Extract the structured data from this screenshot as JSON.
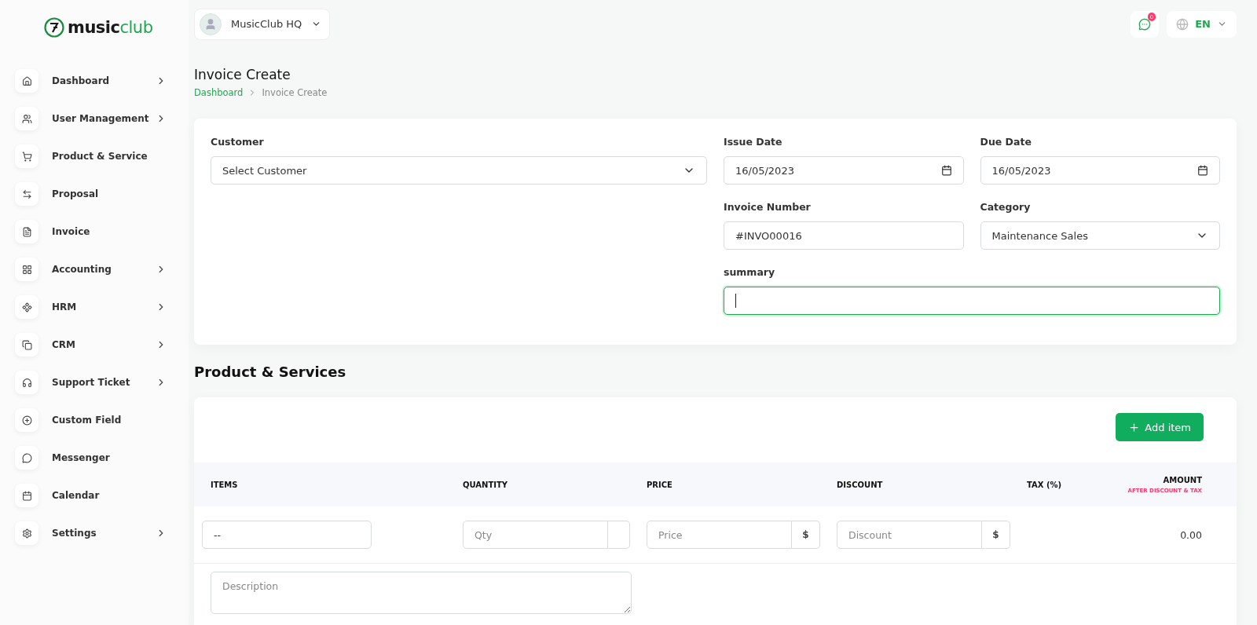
{
  "logo": {
    "part1": "music",
    "part2": "club"
  },
  "workspace": {
    "name": "MusicClub HQ"
  },
  "topbar": {
    "notifications": "0",
    "language": "EN"
  },
  "sidebar": {
    "items": [
      {
        "label": "Dashboard",
        "has_submenu": true
      },
      {
        "label": "User Management",
        "has_submenu": true
      },
      {
        "label": "Product & Service",
        "has_submenu": false
      },
      {
        "label": "Proposal",
        "has_submenu": false
      },
      {
        "label": "Invoice",
        "has_submenu": false
      },
      {
        "label": "Accounting",
        "has_submenu": true
      },
      {
        "label": "HRM",
        "has_submenu": true
      },
      {
        "label": "CRM",
        "has_submenu": true
      },
      {
        "label": "Support Ticket",
        "has_submenu": true
      },
      {
        "label": "Custom Field",
        "has_submenu": false
      },
      {
        "label": "Messenger",
        "has_submenu": false
      },
      {
        "label": "Calendar",
        "has_submenu": false
      },
      {
        "label": "Settings",
        "has_submenu": true
      }
    ]
  },
  "page": {
    "title": "Invoice Create",
    "breadcrumb": [
      "Dashboard",
      "Invoice Create"
    ]
  },
  "form": {
    "customer": {
      "label": "Customer",
      "value": "Select Customer"
    },
    "issue_date": {
      "label": "Issue Date",
      "value": "16/05/2023"
    },
    "due_date": {
      "label": "Due Date",
      "value": "16/05/2023"
    },
    "invoice_number": {
      "label": "Invoice Number",
      "value": "#INVO00016"
    },
    "category": {
      "label": "Category",
      "value": "Maintenance Sales"
    },
    "summary": {
      "label": "summary",
      "focused": true
    }
  },
  "products": {
    "title": "Product & Services",
    "add_button": "Add item",
    "columns": [
      "ITEMS",
      "QUANTITY",
      "PRICE",
      "DISCOUNT",
      "TAX (%)",
      "AMOUNT"
    ],
    "amount_note": "AFTER DISCOUNT & TAX",
    "rows": [
      {
        "item": "--",
        "quantity_placeholder": "Qty",
        "price_placeholder": "Price",
        "price_unit": "$",
        "discount_placeholder": "Discount",
        "discount_unit": "$",
        "amount": "0.00",
        "description_placeholder": "Description"
      }
    ]
  }
}
